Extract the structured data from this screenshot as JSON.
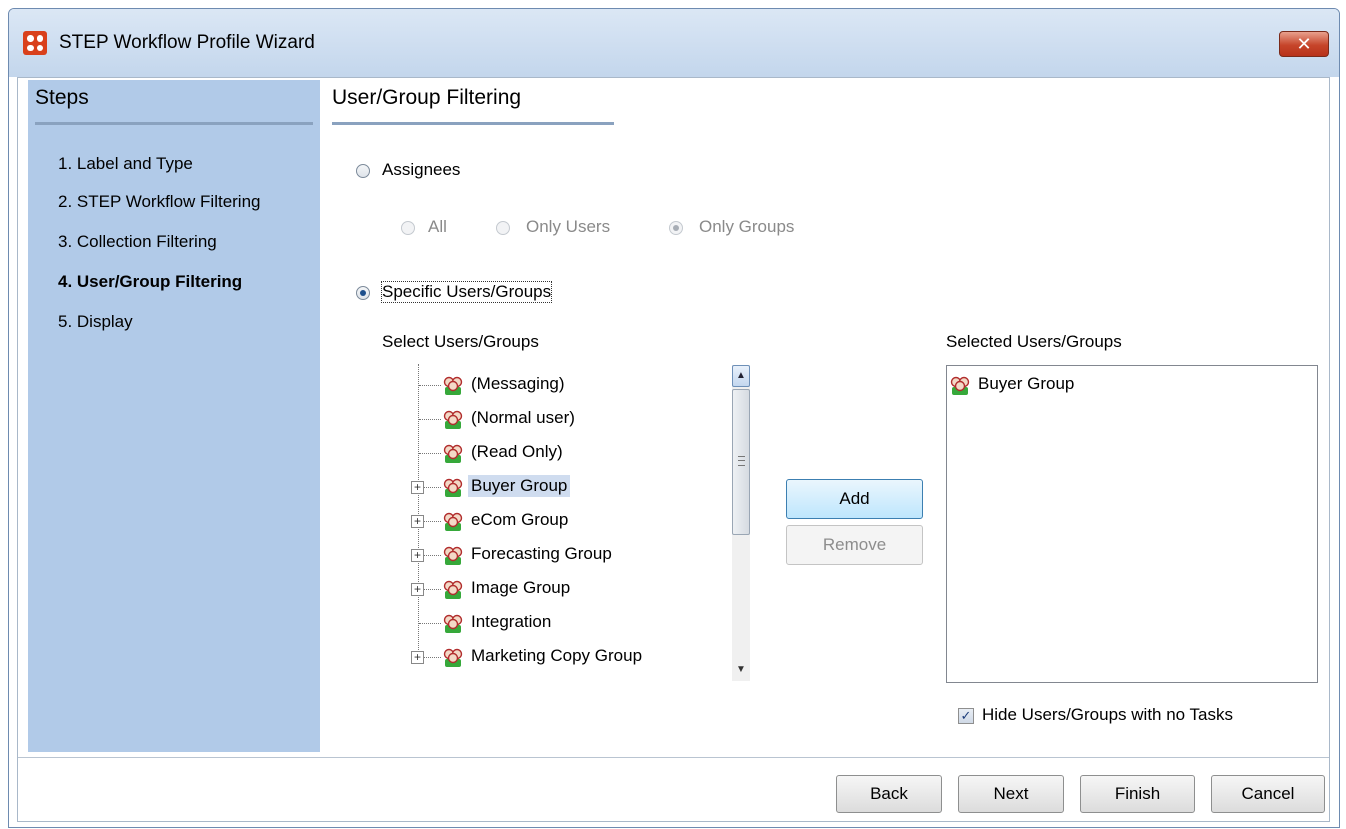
{
  "window": {
    "title": "STEP Workflow Profile Wizard",
    "close_glyph": "✕"
  },
  "steps_panel": {
    "title": "Steps",
    "items": [
      {
        "label": "1. Label and Type",
        "active": false
      },
      {
        "label": "2. STEP Workflow Filtering",
        "active": false
      },
      {
        "label": "3. Collection Filtering",
        "active": false
      },
      {
        "label": "4. User/Group Filtering",
        "active": true
      },
      {
        "label": "5. Display",
        "active": false
      }
    ]
  },
  "main": {
    "title": "User/Group Filtering",
    "assignees": {
      "label": "Assignees",
      "selected": false
    },
    "assignee_options": [
      {
        "label": "All",
        "selected": false,
        "enabled": false
      },
      {
        "label": "Only Users",
        "selected": false,
        "enabled": false
      },
      {
        "label": "Only Groups",
        "selected": true,
        "enabled": false
      }
    ],
    "specific": {
      "label": "Specific Users/Groups",
      "selected": true
    },
    "select_heading": "Select Users/Groups",
    "tree_items": [
      {
        "label": "(Messaging)",
        "expandable": false,
        "selected": false
      },
      {
        "label": "(Normal user)",
        "expandable": false,
        "selected": false
      },
      {
        "label": "(Read Only)",
        "expandable": false,
        "selected": false
      },
      {
        "label": "Buyer Group",
        "expandable": true,
        "selected": true
      },
      {
        "label": "eCom Group",
        "expandable": true,
        "selected": false
      },
      {
        "label": "Forecasting Group",
        "expandable": true,
        "selected": false
      },
      {
        "label": "Image Group",
        "expandable": true,
        "selected": false
      },
      {
        "label": "Integration",
        "expandable": false,
        "selected": false
      },
      {
        "label": "Marketing Copy Group",
        "expandable": true,
        "selected": false
      }
    ],
    "add_label": "Add",
    "remove_label": "Remove",
    "selected_heading": "Selected Users/Groups",
    "selected_items": [
      {
        "label": "Buyer Group"
      }
    ],
    "hide_checkbox": {
      "label": "Hide Users/Groups with no Tasks",
      "checked": true
    }
  },
  "footer": {
    "back_label": "Back",
    "next_label": "Next",
    "finish_label": "Finish",
    "cancel_label": "Cancel"
  },
  "icons": {
    "app": "step-app-icon",
    "group": "user-group-icon",
    "expand": "plus-expander-icon",
    "scroll_up": "▲",
    "scroll_down": "▼",
    "check": "✓"
  },
  "colors": {
    "steps_panel_bg": "#b1cae8",
    "selection_bg": "#cfdcef",
    "close_button": "#c6452a",
    "default_button": "#bee6fd"
  }
}
